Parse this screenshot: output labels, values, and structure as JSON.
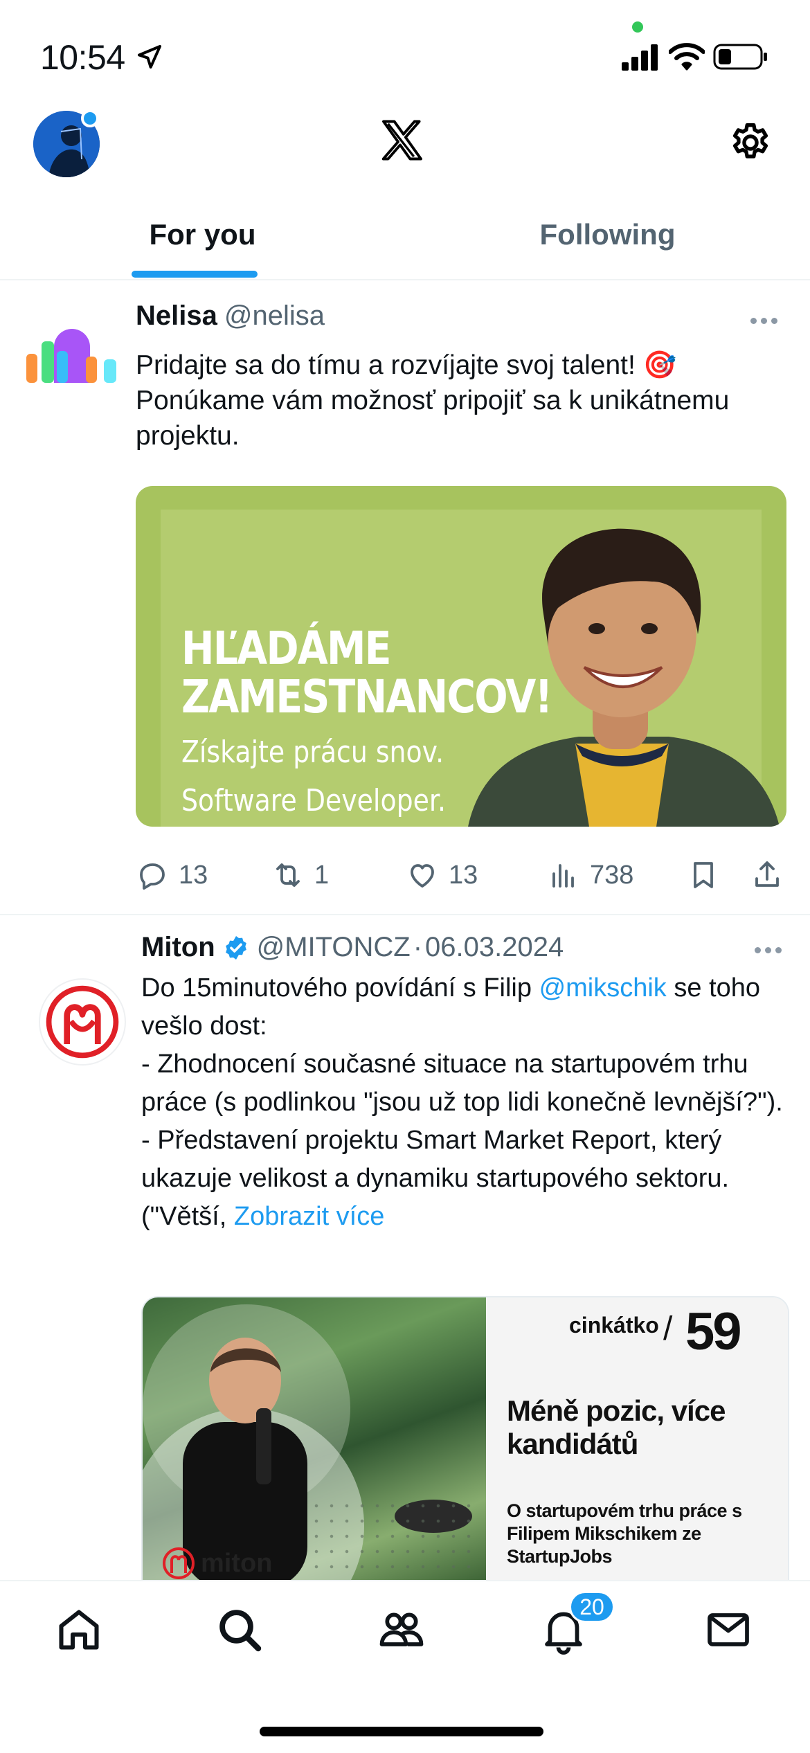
{
  "status": {
    "time": "10:54"
  },
  "tabs": [
    {
      "label": "For you",
      "active": true
    },
    {
      "label": "Following",
      "active": false
    }
  ],
  "posts": [
    {
      "name": "Nelisa",
      "handle": "@nelisa",
      "text": "Pridajte sa do tímu a rozvíjajte svoj talent! 🎯 Ponúkame vám možnosť pripojiť sa k unikátnemu projektu.",
      "media": {
        "headline_1": "HĽADÁME",
        "headline_2": "ZAMESTNANCOV!",
        "sub_1": "Získajte prácu snov.",
        "sub_2": "Software Developer."
      },
      "stats": {
        "replies": "13",
        "reposts": "1",
        "likes": "13",
        "views": "738"
      }
    },
    {
      "name": "Miton",
      "handle": "@MITONCZ",
      "separator": "·",
      "date": "06.03.2024",
      "text_1": "Do 15minutového povídání s Filip",
      "mention": "@mikschik",
      "text_2": "se toho vešlo dost:",
      "text_3": "- Zhodnocení současné situace na startupovém trhu práce (s podlinkou \"jsou už top lidi konečně levnější?\").",
      "text_4": "- Představení projektu Smart Market Report, který ukazuje velikost a dynamiku startupového sektoru. (\"Větší,",
      "show_more": "Zobrazit více",
      "media": {
        "series": "cinkátko",
        "slash": "/",
        "episode": "59",
        "title": "Méně pozic, více kandidátů",
        "subtitle": "O startupovém trhu práce s Filipem Mikschikem ze StartupJobs",
        "brand": "miton"
      }
    }
  ],
  "nav": {
    "notifications_badge": "20"
  },
  "colors": {
    "accent": "#1d9bf0",
    "muted": "#536471",
    "text": "#0f1419",
    "media_green": "#b4cc6f"
  },
  "icons": [
    "location-arrow-icon",
    "signal-icon",
    "wifi-icon",
    "battery-icon",
    "x-logo-icon",
    "gear-icon",
    "reply-icon",
    "repost-icon",
    "like-icon",
    "views-icon",
    "bookmark-icon",
    "share-icon",
    "verified-icon",
    "home-icon",
    "search-icon",
    "communities-icon",
    "bell-icon",
    "mail-icon"
  ]
}
